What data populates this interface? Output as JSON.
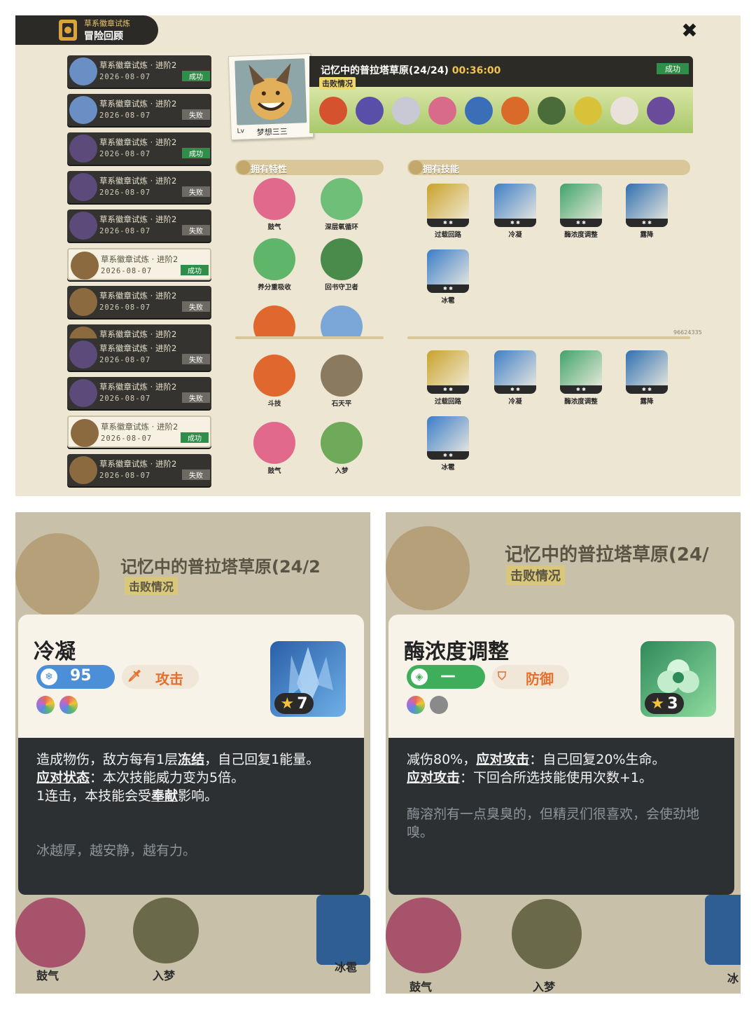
{
  "header": {
    "subtitle": "草系徽章试炼",
    "title": "冒险回顾",
    "close": "✖"
  },
  "history": [
    {
      "title": "草系徽章试炼 · 进阶2",
      "date": "2026-08-07",
      "result": "成功",
      "avatar_color": "#6a8fc4",
      "selected": false
    },
    {
      "title": "草系徽章试炼 · 进阶2",
      "date": "2026-08-07",
      "result": "失败",
      "avatar_color": "#6a8fc4",
      "selected": false
    },
    {
      "title": "草系徽章试炼 · 进阶2",
      "date": "2026-08-07",
      "result": "成功",
      "avatar_color": "#5b4a7a",
      "selected": false
    },
    {
      "title": "草系徽章试炼 · 进阶2",
      "date": "2026-08-07",
      "result": "失败",
      "avatar_color": "#5b4a7a",
      "selected": false
    },
    {
      "title": "草系徽章试炼 · 进阶2",
      "date": "2026-08-07",
      "result": "失败",
      "avatar_color": "#5b4a7a",
      "selected": false
    },
    {
      "title": "草系徽章试炼 · 进阶2",
      "date": "2026-08-07",
      "result": "成功",
      "avatar_color": "#8a6a3e",
      "selected": true
    },
    {
      "title": "草系徽章试炼 · 进阶2",
      "date": "2026-08-07",
      "result": "失败",
      "avatar_color": "#8a6a3e",
      "selected": false
    },
    {
      "title": "草系徽章试炼 · 进阶2",
      "date": "",
      "result": "",
      "avatar_color": "#8a6a3e",
      "selected": false
    },
    {
      "title": "草系徽章试炼 · 进阶2",
      "date": "2026-08-07",
      "result": "失败",
      "avatar_color": "#5b4a7a",
      "selected": false
    },
    {
      "title": "草系徽章试炼 · 进阶2",
      "date": "2026-08-07",
      "result": "失败",
      "avatar_color": "#5b4a7a",
      "selected": false
    },
    {
      "title": "草系徽章试炼 · 进阶2",
      "date": "2026-08-07",
      "result": "成功",
      "avatar_color": "#8a6a3e",
      "selected": true
    },
    {
      "title": "草系徽章试炼 · 进阶2",
      "date": "2026-08-07",
      "result": "失败",
      "avatar_color": "#8a6a3e",
      "selected": false
    }
  ],
  "battle": {
    "level": "Lv",
    "player_name": "梦想三三",
    "map": "记忆中的普拉塔草原(24/24)",
    "time": "00:36:00",
    "result": "成功",
    "defeated_label": "击败情况",
    "monster_colors": [
      "#d4522e",
      "#5a4fa8",
      "#c9c9d6",
      "#d86a8a",
      "#3a6fb8",
      "#d96a2a",
      "#4a6b3a",
      "#d8c23a",
      "#e8e2da",
      "#6a4a9a"
    ]
  },
  "sections": {
    "traits": "拥有特性",
    "skills": "拥有技能"
  },
  "uid": "96624335",
  "traits_a": [
    {
      "name": "鼓气",
      "color": "#e16a8c"
    },
    {
      "name": "深层氧循环",
      "color": "#6fbf78"
    },
    {
      "name": "养分重吸收",
      "color": "#5fb56a"
    },
    {
      "name": "回书守卫者",
      "color": "#4a8a4a"
    },
    {
      "name": "",
      "color": "#e0682e"
    },
    {
      "name": "",
      "color": "#7aa6d8"
    }
  ],
  "traits_b": [
    {
      "name": "斗技",
      "color": "#e0682e"
    },
    {
      "name": "石天平",
      "color": "#8a7a60"
    },
    {
      "name": "鼓气",
      "color": "#e16a8c"
    },
    {
      "name": "入梦",
      "color": "#6faa5a"
    }
  ],
  "skills": [
    {
      "name": "过载回路",
      "color": "#c9a22a"
    },
    {
      "name": "冷凝",
      "color": "#3f7fc6"
    },
    {
      "name": "酶浓度调整",
      "color": "#3fa36a"
    },
    {
      "name": "露降",
      "color": "#2f6fb0"
    },
    {
      "name": "冰雹",
      "color": "#3a7cc8"
    }
  ],
  "popup_left": {
    "bg_title": "记忆中的普拉塔草原(24/2",
    "bg_defeated": "击败情况",
    "title": "冷凝",
    "energy_icon": "❄",
    "energy": "95",
    "category_icon": "sword-icon",
    "category": "攻击",
    "stars": "7",
    "desc_1": "造成物伤，敌方每有1层",
    "desc_kw1": "冻结",
    "desc_2": "，自己回复1能量。",
    "desc_kw2": "应对状态",
    "desc_3": "：本次技能威力变为5倍。",
    "desc_4": "1连击，本技能会受",
    "desc_kw3": "奉献",
    "desc_5": "影响。",
    "flavor": "冰越厚，越安静，越有力。",
    "bottom_traits": [
      "鼓气",
      "入梦",
      "冰雹"
    ],
    "pill_color": "#4a8fd8",
    "art_color": "#3f7fc6"
  },
  "popup_right": {
    "bg_title": "记忆中的普拉塔草原(24/",
    "bg_defeated": "击败情况",
    "title": "酶浓度调整",
    "energy_icon": "◈",
    "energy": "—",
    "category_icon": "shield-icon",
    "category": "防御",
    "stars": "3",
    "desc_1": "减伤80%，",
    "desc_kw1": "应对攻击",
    "desc_2": "：自己回复20%生命。",
    "desc_kw2": "应对攻击",
    "desc_3": "：下回合所选技能使用次数+1。",
    "flavor": "酶溶剂有一点臭臭的，但精灵们很喜欢，会使劲地嗅。",
    "bottom_traits": [
      "鼓气",
      "入梦",
      "冰"
    ],
    "pill_color": "#3fae5a",
    "art_color": "#3fa36a"
  }
}
